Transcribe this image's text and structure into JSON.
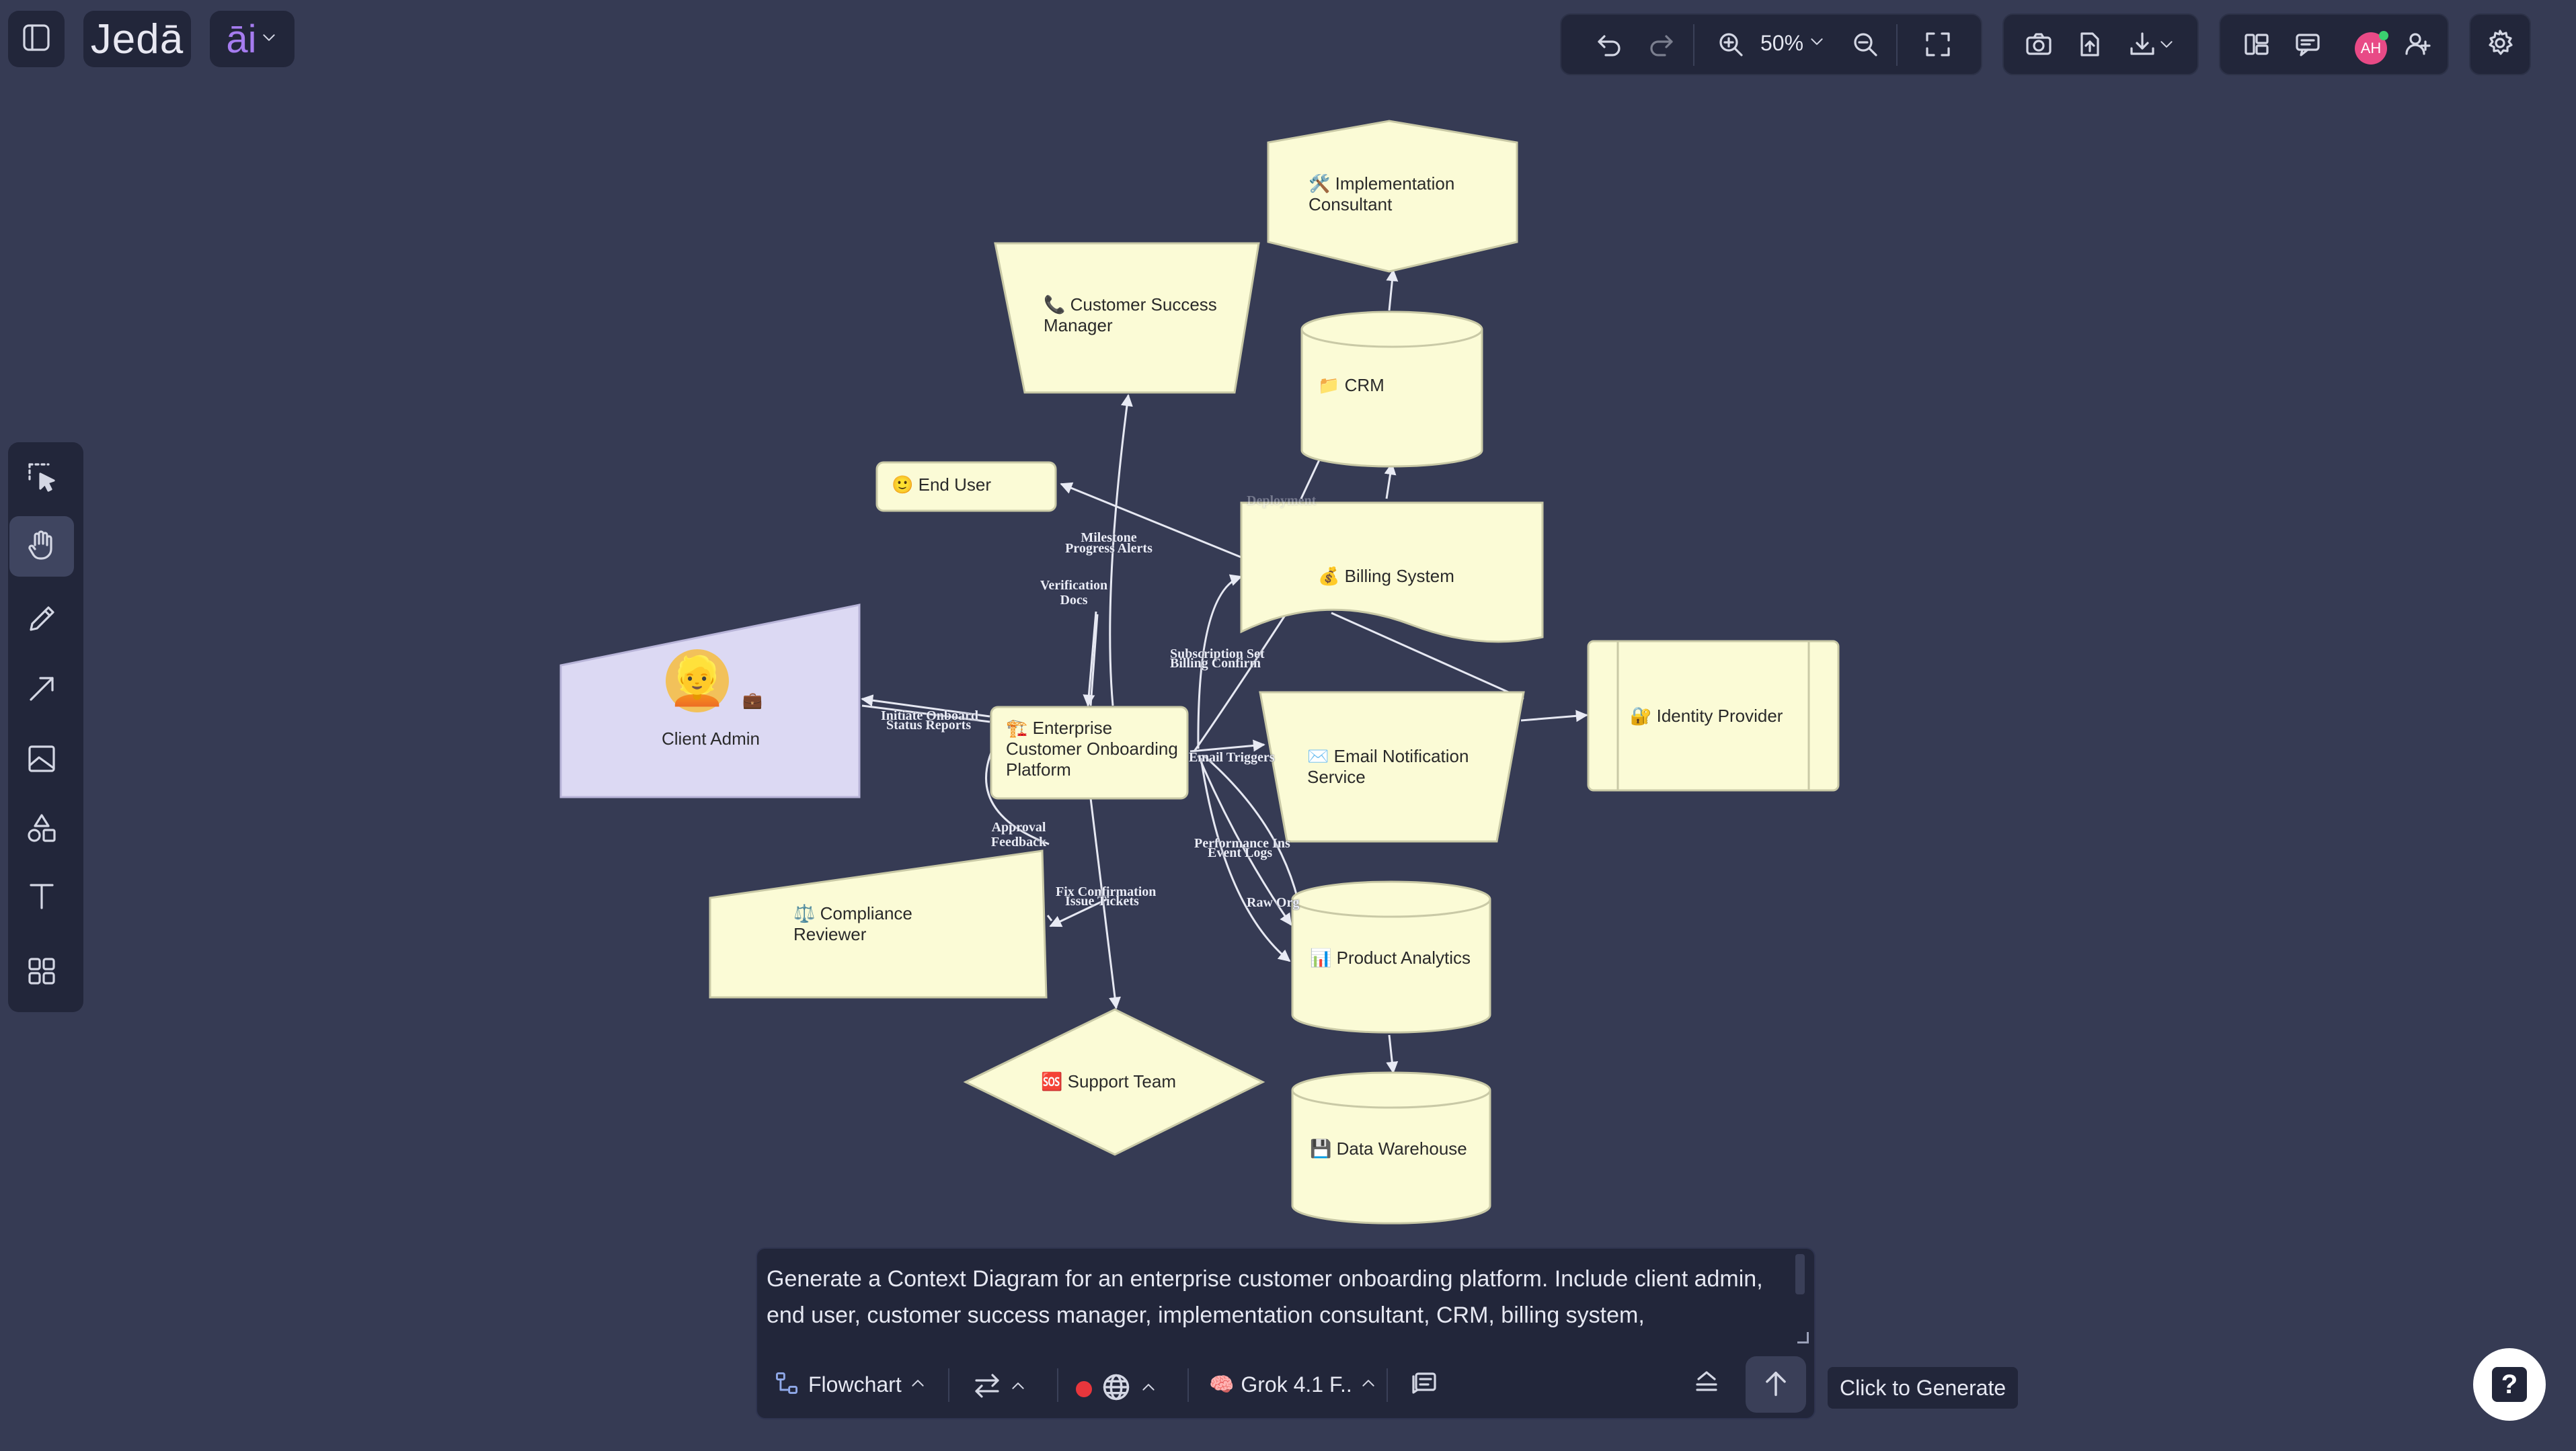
{
  "app": {
    "logo_text": "Jedā",
    "ai_badge": "āi"
  },
  "toolbar": {
    "zoom_level": "50%",
    "avatar_initials": "AH",
    "avatar_color": "#e84a86"
  },
  "left_tools": [
    {
      "icon": "select-icon"
    },
    {
      "icon": "hand-icon"
    },
    {
      "icon": "pencil-icon"
    },
    {
      "icon": "arrow-icon"
    },
    {
      "icon": "image-icon"
    },
    {
      "icon": "shapes-icon"
    },
    {
      "icon": "text-icon"
    },
    {
      "icon": "grid-icon"
    }
  ],
  "diagram": {
    "nodes": {
      "implementation_consultant": "🛠️ Implementation Consultant",
      "customer_success_manager": "📞 Customer Success Manager",
      "crm": "📁 CRM",
      "end_user": "🙂 End User",
      "billing_system": "💰 Billing System",
      "client_admin": "Client Admin",
      "platform": "🏗️ Enterprise Customer Onboarding Platform",
      "identity_provider": "🔐 Identity Provider",
      "email_service": "✉️ Email Notification Service",
      "compliance_reviewer": "⚖️ Compliance Reviewer",
      "product_analytics": "📊 Product Analytics",
      "support_team": "🆘 Support Team",
      "data_warehouse": "💾 Data Warehouse"
    },
    "edges": {
      "milestone_progress": "Milestone Progress Alerts",
      "verification_docs": "Verification Docs",
      "initiate_onboard": "Initiate Onboard",
      "status_reports": "Status Reports",
      "subscription": "Subscription Set",
      "billing_confirm": "Billing Confirm",
      "email_triggers": "Email Triggers",
      "approval_feedback": "Approval Feedback",
      "fix_confirmation": "Fix Confirmation",
      "issue_tickets": "Issue Tickets",
      "performance": "Performance Ins",
      "event_logs": "Event Logs",
      "raw_org": "Raw Org",
      "deployment": "Deployment"
    }
  },
  "prompt": {
    "text": "Generate a Context Diagram for an enterprise customer onboarding platform. Include client admin, end user, customer success manager, implementation consultant, CRM, billing system,",
    "diagram_type": "Flowchart",
    "model": "Grok 4.1 F..",
    "generate_tooltip": "Click to Generate"
  },
  "colors": {
    "canvas": "#363b54",
    "node_fill": "#fbfbd6",
    "client_admin_fill": "#dcd9f3",
    "toolbar_bg": "#22263a",
    "record_dot": "#e8363c"
  }
}
